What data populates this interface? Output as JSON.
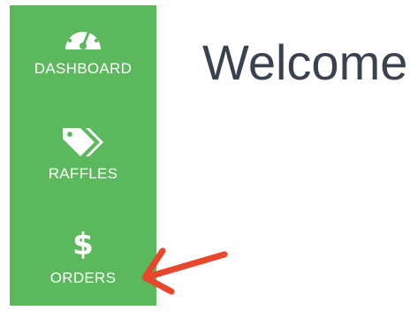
{
  "sidebar": {
    "items": [
      {
        "icon": "speedometer-icon",
        "label": "DASHBOARD"
      },
      {
        "icon": "tags-icon",
        "label": "RAFFLES"
      },
      {
        "icon": "dollar-icon",
        "label": "ORDERS"
      }
    ]
  },
  "main": {
    "title": "Welcome"
  },
  "colors": {
    "sidebar_bg": "#5cb85c",
    "sidebar_text": "#ffffff",
    "title_text": "#3a4250",
    "annotation_arrow": "#e8472c"
  }
}
